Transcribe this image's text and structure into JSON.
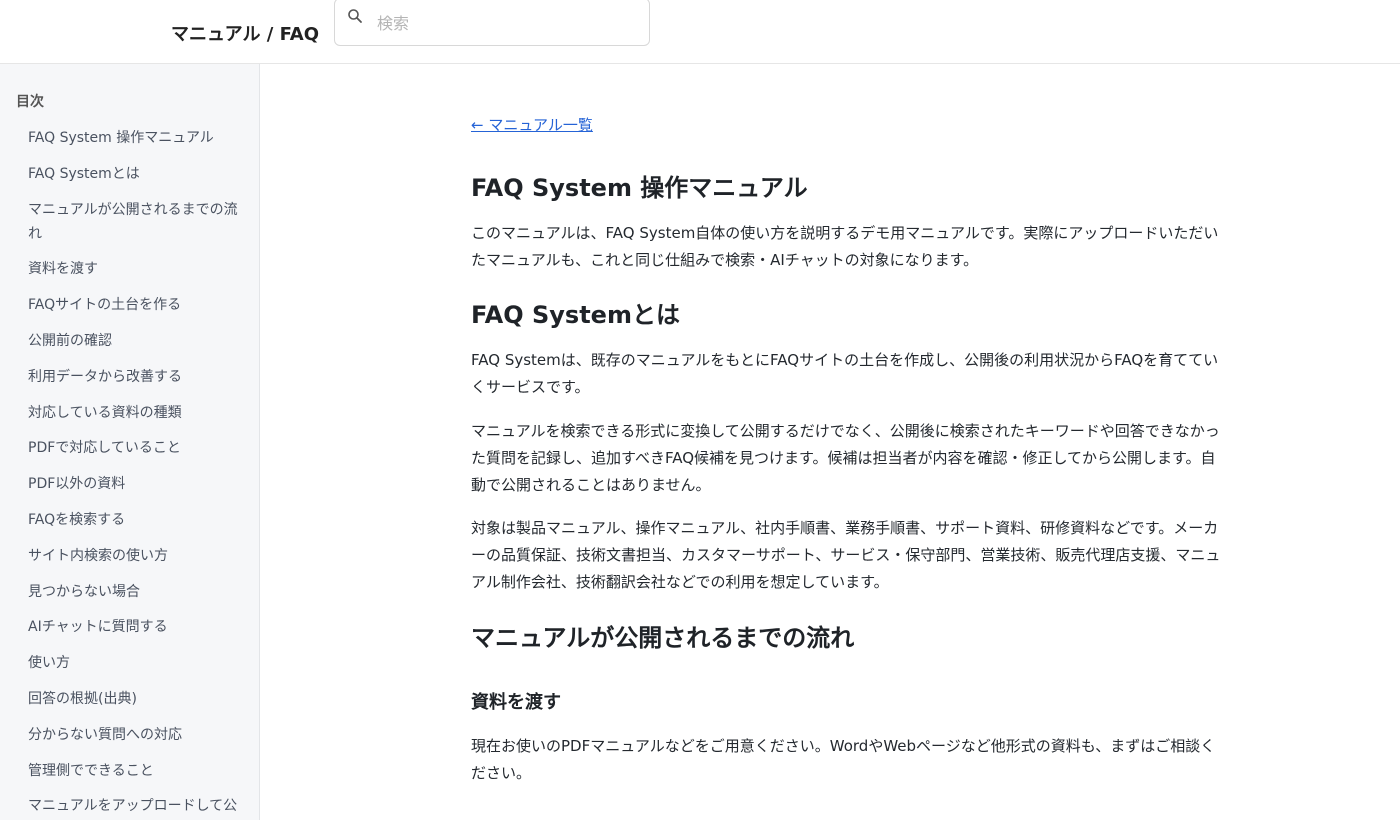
{
  "header": {
    "title": "マニュアル / FAQ",
    "search": {
      "placeholder": "検索",
      "value": "",
      "icon": "search-icon"
    }
  },
  "sidebar": {
    "heading": "目次",
    "items": [
      {
        "label": "FAQ System 操作マニュアル"
      },
      {
        "label": "FAQ Systemとは"
      },
      {
        "label": "マニュアルが公開されるまでの流れ"
      },
      {
        "label": "資料を渡す"
      },
      {
        "label": "FAQサイトの土台を作る"
      },
      {
        "label": "公開前の確認"
      },
      {
        "label": "利用データから改善する"
      },
      {
        "label": "対応している資料の種類"
      },
      {
        "label": "PDFで対応していること"
      },
      {
        "label": "PDF以外の資料"
      },
      {
        "label": "FAQを検索する"
      },
      {
        "label": "サイト内検索の使い方"
      },
      {
        "label": "見つからない場合"
      },
      {
        "label": "AIチャットに質問する"
      },
      {
        "label": "使い方"
      },
      {
        "label": "回答の根拠(出典)"
      },
      {
        "label": "分からない質問への対応"
      },
      {
        "label": "管理側でできること"
      },
      {
        "label": "マニュアルをアップロードして公開する"
      }
    ]
  },
  "main": {
    "back_link": "← マニュアル一覧",
    "title": "FAQ System 操作マニュアル",
    "intro": "このマニュアルは、FAQ System自体の使い方を説明するデモ用マニュアルです。実際にアップロードいただいたマニュアルも、これと同じ仕組みで検索・AIチャットの対象になります。",
    "section1": {
      "heading": "FAQ Systemとは",
      "p1": "FAQ Systemは、既存のマニュアルをもとにFAQサイトの土台を作成し、公開後の利用状況からFAQを育てていくサービスです。",
      "p2": "マニュアルを検索できる形式に変換して公開するだけでなく、公開後に検索されたキーワードや回答できなかった質問を記録し、追加すべきFAQ候補を見つけます。候補は担当者が内容を確認・修正してから公開します。自動で公開されることはありません。",
      "p3": "対象は製品マニュアル、操作マニュアル、社内手順書、業務手順書、サポート資料、研修資料などです。メーカーの品質保証、技術文書担当、カスタマーサポート、サービス・保守部門、営業技術、販売代理店支援、マニュアル制作会社、技術翻訳会社などでの利用を想定しています。"
    },
    "section2": {
      "heading": "マニュアルが公開されるまでの流れ",
      "sub1": {
        "heading": "資料を渡す",
        "p1": "現在お使いのPDFマニュアルなどをご用意ください。WordやWebページなど他形式の資料も、まずはご相談ください。"
      }
    }
  }
}
